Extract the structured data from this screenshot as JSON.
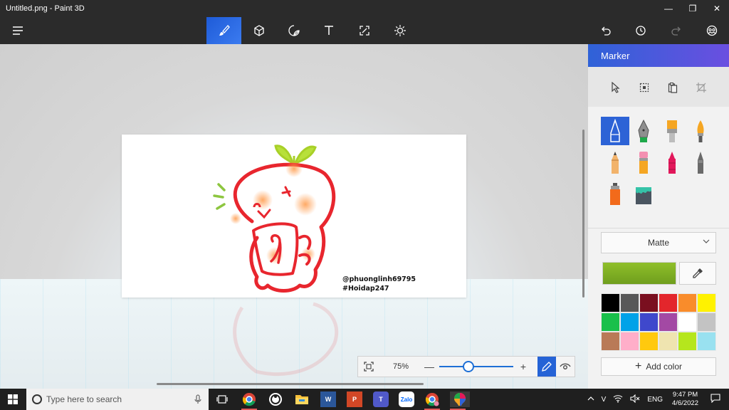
{
  "window": {
    "title": "Untitled.png - Paint 3D",
    "minimize_glyph": "—",
    "restore_glyph": "❐",
    "close_glyph": "✕"
  },
  "toolbar": {
    "icons": [
      "menu-icon",
      "brushes-icon",
      "3d-shapes-icon",
      "stickers-icon",
      "text-icon",
      "canvas-icon",
      "effects-icon",
      "undo-icon",
      "history-icon",
      "redo-icon",
      "community-icon"
    ],
    "active_tab": "brushes"
  },
  "canvas": {
    "watermark_line1": "@phuonglinh69795",
    "watermark_line2": "#Hoidap247"
  },
  "zoom": {
    "percent": "75%",
    "level": 0.38,
    "minus": "—",
    "plus": "+"
  },
  "panel": {
    "title": "Marker",
    "finish": "Matte",
    "current_color": "#7fb024",
    "add_color_label": "Add color",
    "brushes": [
      "marker",
      "calligraphy-pen",
      "oil-brush",
      "watercolor",
      "pencil",
      "eraser",
      "crayon",
      "pixel-pen",
      "spray-can",
      "fill"
    ],
    "palette": [
      "#000000",
      "#585858",
      "#7a0f1f",
      "#e3262c",
      "#f98c2b",
      "#fff200",
      "#19c04b",
      "#00a2e8",
      "#3f48cc",
      "#a349a4",
      "#ffffff",
      "#c3c3c3",
      "#b97a57",
      "#ffaec9",
      "#ffc90e",
      "#efe4b0",
      "#b5e61d",
      "#99e1f0"
    ]
  },
  "taskbar": {
    "search_placeholder": "Type here to search",
    "apps": [
      "task-view",
      "chrome",
      "obs",
      "file-explorer",
      "word",
      "powerpoint",
      "teams",
      "zalo",
      "chrome-profile",
      "paint-3d"
    ],
    "word_label": "W",
    "ppt_label": "P",
    "teams_label": "T",
    "zalo_label": "Zalo",
    "ime": "V",
    "language": "ENG",
    "time": "9:47 PM",
    "date": "4/6/2022"
  }
}
